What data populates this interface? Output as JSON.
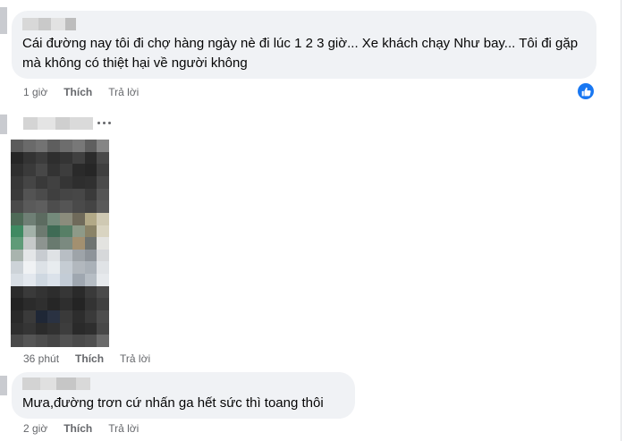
{
  "comments": [
    {
      "text": "Cái đường nay tôi đi chợ hàng ngày nè đi lúc 1 2 3 giờ... Xe khách chạy Như bay... Tôi đi gặp mà không có thiệt hại về người không",
      "time": "1 giờ",
      "like": "Thích",
      "reply": "Trả lời",
      "reaction_icon": "thumbs-up-icon",
      "reaction_color": "#1877f2"
    },
    {
      "time": "36 phút",
      "like": "Thích",
      "reply": "Trả lời",
      "attachment": "blurred-image"
    },
    {
      "text": "Mưa,đường trơn cứ nhấn ga hết sức thì toang thôi",
      "time": "2 giờ",
      "like": "Thích",
      "reply": "Trả lời"
    }
  ]
}
